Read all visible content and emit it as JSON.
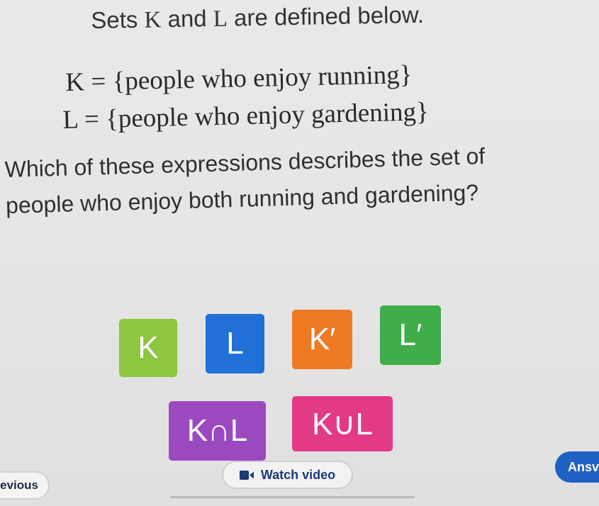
{
  "problem": {
    "intro_prefix": "Sets ",
    "set1_name": "K",
    "intro_and": " and ",
    "set2_name": "L",
    "intro_suffix": " are defined below.",
    "def_k": "K = {people who enjoy running}",
    "def_l": "L = {people who enjoy gardening}",
    "question_line1": "Which of these expressions describes the set of",
    "question_line2": "people who enjoy both running and gardening?"
  },
  "choices": [
    {
      "label": "K",
      "color": "#8dc63f"
    },
    {
      "label": "L",
      "color": "#2070d8"
    },
    {
      "label": "K′",
      "color": "#f07a24"
    },
    {
      "label": "L′",
      "color": "#3fae4a"
    },
    {
      "label": "K∩L",
      "color": "#9b49bf"
    },
    {
      "label": "K∪L",
      "color": "#e23a87"
    }
  ],
  "footer": {
    "previous_label": "evious",
    "watch_video_label": "Watch video",
    "video_icon": "video-camera-icon",
    "answer_label": "Ansv"
  },
  "colors": {
    "answer_button": "#1f60c4",
    "video_text": "#1d3b7a"
  }
}
